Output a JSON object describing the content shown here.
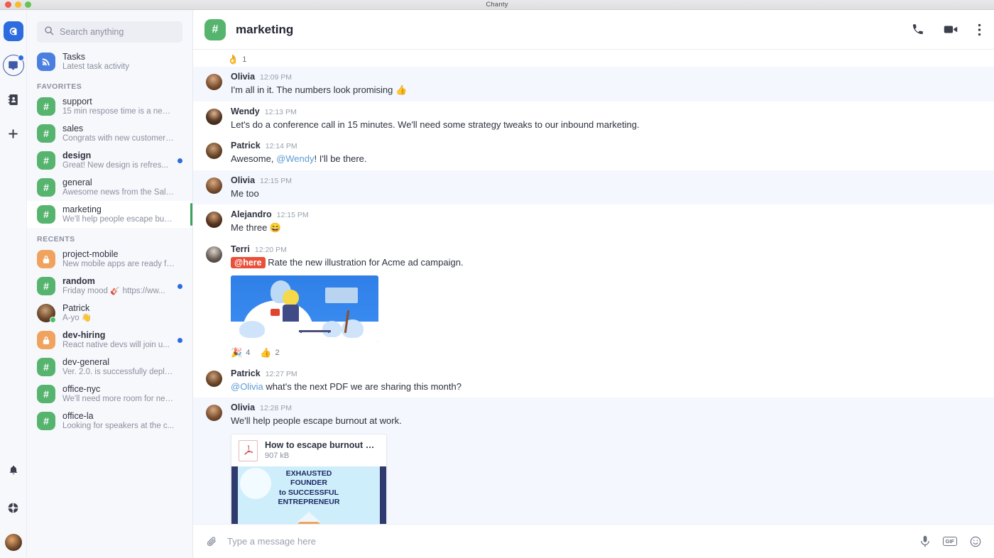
{
  "window": {
    "title": "Chanty",
    "traffic_lights": [
      "close-red",
      "minimize-yellow",
      "maximize-green"
    ]
  },
  "rail": {
    "logo": "chanty-logo-icon",
    "items": [
      {
        "name": "chats-icon",
        "label": "Chats",
        "badge": true
      },
      {
        "name": "contacts-icon",
        "label": "Contacts",
        "badge": false
      },
      {
        "name": "add-icon",
        "label": "Add",
        "badge": false
      }
    ],
    "bottom_items": [
      {
        "name": "notifications-bell-icon",
        "label": "Notifications"
      },
      {
        "name": "apps-grid-icon",
        "label": "Apps"
      },
      {
        "name": "user-avatar",
        "label": "Profile"
      }
    ]
  },
  "sidebar": {
    "search": {
      "placeholder": "Search anything",
      "value": ""
    },
    "tasks": {
      "title": "Tasks",
      "subtitle": "Latest task activity",
      "icon": "rss-feed-icon"
    },
    "sections": [
      {
        "label": "FAVORITES",
        "items": [
          {
            "title": "support",
            "subtitle": "15 min respose time is a new ...",
            "icon": "hash",
            "color": "green",
            "bold": false,
            "unread": false,
            "selected": false
          },
          {
            "title": "sales",
            "subtitle": "Congrats with new customers...",
            "icon": "hash",
            "color": "green",
            "bold": false,
            "unread": false,
            "selected": false
          },
          {
            "title": "design",
            "subtitle": "Great! New design is refres...",
            "icon": "hash",
            "color": "green",
            "bold": true,
            "unread": true,
            "selected": false
          },
          {
            "title": "general",
            "subtitle": "Awesome news from the Sale...",
            "icon": "hash",
            "color": "green",
            "bold": false,
            "unread": false,
            "selected": false
          },
          {
            "title": "marketing",
            "subtitle": "We'll help people escape burn...",
            "icon": "hash",
            "color": "green",
            "bold": false,
            "unread": false,
            "selected": true
          }
        ]
      },
      {
        "label": "RECENTS",
        "items": [
          {
            "title": "project-mobile",
            "subtitle": "New mobile apps are ready fo...",
            "icon": "lock",
            "color": "orange",
            "bold": false,
            "unread": false,
            "selected": false
          },
          {
            "title": "random",
            "subtitle": "Friday mood 🎸 https://ww...",
            "icon": "hash",
            "color": "green",
            "bold": true,
            "unread": true,
            "selected": false
          },
          {
            "title": "Patrick",
            "subtitle": "A-yo 👋",
            "icon": "photo",
            "color": "photo",
            "bold": false,
            "unread": false,
            "selected": false,
            "online": true
          },
          {
            "title": "dev-hiring",
            "subtitle": "React native devs will join u...",
            "icon": "lock",
            "color": "orange",
            "bold": true,
            "unread": true,
            "selected": false
          },
          {
            "title": "dev-general",
            "subtitle": "Ver. 2.0. is successfully deplo...",
            "icon": "hash",
            "color": "green",
            "bold": false,
            "unread": false,
            "selected": false
          },
          {
            "title": "office-nyc",
            "subtitle": "We'll need more room for new...",
            "icon": "hash",
            "color": "green",
            "bold": false,
            "unread": false,
            "selected": false
          },
          {
            "title": "office-la",
            "subtitle": "Looking for speakers at the c...",
            "icon": "hash",
            "color": "green",
            "bold": false,
            "unread": false,
            "selected": false
          }
        ]
      }
    ]
  },
  "channel_header": {
    "name": "marketing",
    "icon": "hash",
    "actions": [
      {
        "name": "phone-call-icon",
        "label": "Call"
      },
      {
        "name": "video-call-icon",
        "label": "Video call"
      },
      {
        "name": "more-options-icon",
        "label": "More"
      }
    ]
  },
  "top_reaction": {
    "emoji": "👌",
    "count": "1"
  },
  "messages": [
    {
      "author": "Olivia",
      "time": "12:09 PM",
      "avatar": "av-olivia",
      "highlight": true,
      "text_before": "I'm all in it. The numbers look promising ",
      "emoji_suffix": "👍"
    },
    {
      "author": "Wendy",
      "time": "12:13 PM",
      "avatar": "av-wendy",
      "highlight": false,
      "text_before": "Let's do a conference call in 15 minutes. We'll need some strategy tweaks to our inbound marketing.",
      "emoji_suffix": ""
    },
    {
      "author": "Patrick",
      "time": "12:14 PM",
      "avatar": "av-patrick",
      "highlight": false,
      "text_before": "Awesome, ",
      "mention": "@Wendy",
      "text_after": "! I'll be there.",
      "emoji_suffix": ""
    },
    {
      "author": "Olivia",
      "time": "12:15 PM",
      "avatar": "av-olivia",
      "highlight": true,
      "text_before": "Me too",
      "emoji_suffix": ""
    },
    {
      "author": "Alejandro",
      "time": "12:15 PM",
      "avatar": "av-alejandro",
      "highlight": false,
      "text_before": "Me three ",
      "emoji_suffix": "😄"
    },
    {
      "author": "Terri",
      "time": "12:20 PM",
      "avatar": "av-terri",
      "highlight": false,
      "here_badge": "@here",
      "text_after": "Rate the new illustration for Acme ad campaign.",
      "attachment": "illustration-image",
      "reactions": [
        {
          "emoji": "🎉",
          "count": "4"
        },
        {
          "emoji": "👍",
          "count": "2"
        }
      ]
    },
    {
      "author": "Patrick",
      "time": "12:27 PM",
      "avatar": "av-patrick",
      "highlight": false,
      "mention": "@Olivia",
      "text_after": " what's the next PDF we are sharing this month?"
    },
    {
      "author": "Olivia",
      "time": "12:28 PM",
      "avatar": "av-olivia",
      "highlight": true,
      "text_before": "We'll help people escape burnout at work.",
      "pdf": {
        "name": "How to escape burnout at w...",
        "size": "907 kB",
        "icon": "pdf-file-icon",
        "cover_lines": [
          "EXHAUSTED",
          "FOUNDER",
          "to SUCCESSFUL",
          "ENTREPRENEUR"
        ]
      }
    }
  ],
  "composer": {
    "placeholder": "Type a message here",
    "value": "",
    "attach_icon": "paperclip-icon",
    "right_actions": [
      {
        "name": "microphone-icon",
        "label": "Voice message"
      },
      {
        "name": "gif-icon",
        "label": "GIF"
      },
      {
        "name": "emoji-icon",
        "label": "Emoji"
      }
    ],
    "gif_label": "GIF"
  },
  "colors": {
    "brand_blue": "#2d6cdf",
    "channel_green": "#56b46f",
    "private_orange": "#f0a35e",
    "mention_here_red": "#e8503a",
    "highlight_bg": "#f4f7fd"
  }
}
